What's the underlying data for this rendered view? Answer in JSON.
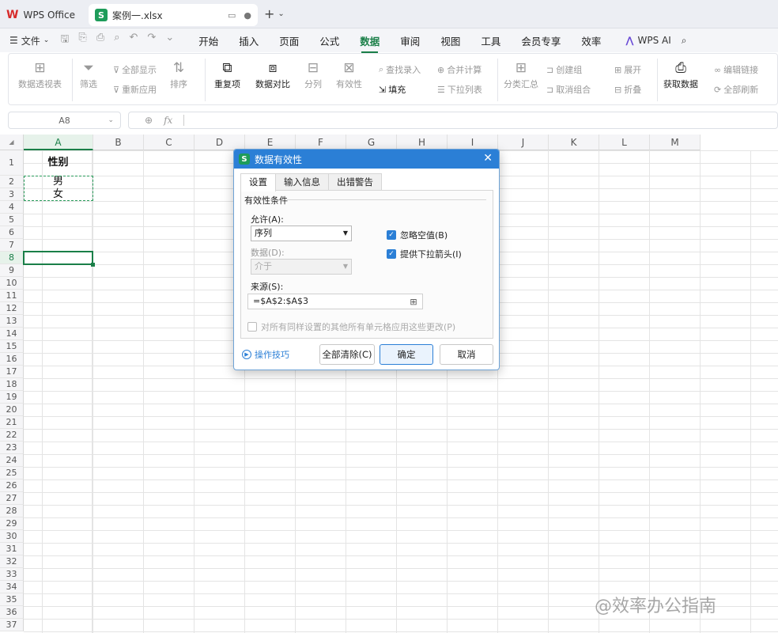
{
  "app": {
    "name": "WPS Office",
    "doc_tab": "案例一.xlsx",
    "doc_badge": "S"
  },
  "menubar": {
    "file": "文件",
    "items": [
      "开始",
      "插入",
      "页面",
      "公式",
      "数据",
      "审阅",
      "视图",
      "工具",
      "会员专享",
      "效率"
    ],
    "active": "数据",
    "ai": "WPS AI"
  },
  "ribbon": {
    "pivot": "数据透视表",
    "filter": "筛选",
    "show_all": "全部显示",
    "reapply": "重新应用",
    "sort": "排序",
    "duplicates": "重复项",
    "compare": "数据对比",
    "split": "分列",
    "validity": "有效性",
    "lookup_entry": "查找录入",
    "fill": "填充",
    "consolidate": "合并计算",
    "dropdown_list": "下拉列表",
    "subtotal": "分类汇总",
    "create_group": "创建组",
    "ungroup": "取消组合",
    "expand": "展开",
    "collapse": "折叠",
    "get_data": "获取数据",
    "edit_links": "编辑链接",
    "refresh_all": "全部刷新"
  },
  "formula_bar": {
    "name_box": "A8",
    "fx": "fx",
    "value": ""
  },
  "sheet": {
    "columns": [
      "A",
      "B",
      "C",
      "D",
      "E",
      "F",
      "G",
      "H",
      "I",
      "J",
      "K",
      "L",
      "M"
    ],
    "rows": [
      "1",
      "2",
      "3",
      "4",
      "5",
      "6",
      "7",
      "8",
      "9",
      "10",
      "11",
      "12",
      "13",
      "14",
      "15",
      "16",
      "17",
      "18",
      "19",
      "20",
      "21",
      "22",
      "23",
      "24",
      "25",
      "26",
      "27",
      "28",
      "29",
      "30",
      "31",
      "32",
      "33",
      "34",
      "35",
      "36",
      "37"
    ],
    "a1": "性别",
    "a2": "男",
    "a3": "女",
    "active_cell": "A8"
  },
  "dialog": {
    "title": "数据有效性",
    "badge": "S",
    "tabs": [
      "设置",
      "输入信息",
      "出错警告"
    ],
    "group": "有效性条件",
    "allow_label": "允许(A):",
    "allow_value": "序列",
    "data_label": "数据(D):",
    "data_value": "介于",
    "ignore_blank": "忽略空值(B)",
    "dropdown_arrow": "提供下拉箭头(I)",
    "source_label": "来源(S):",
    "source_value": "=$A$2:$A$3",
    "apply_all": "对所有同样设置的其他所有单元格应用这些更改(P)",
    "tips": "操作技巧",
    "clear_all": "全部清除(C)",
    "ok": "确定",
    "cancel": "取消"
  },
  "watermark": "@效率办公指南"
}
